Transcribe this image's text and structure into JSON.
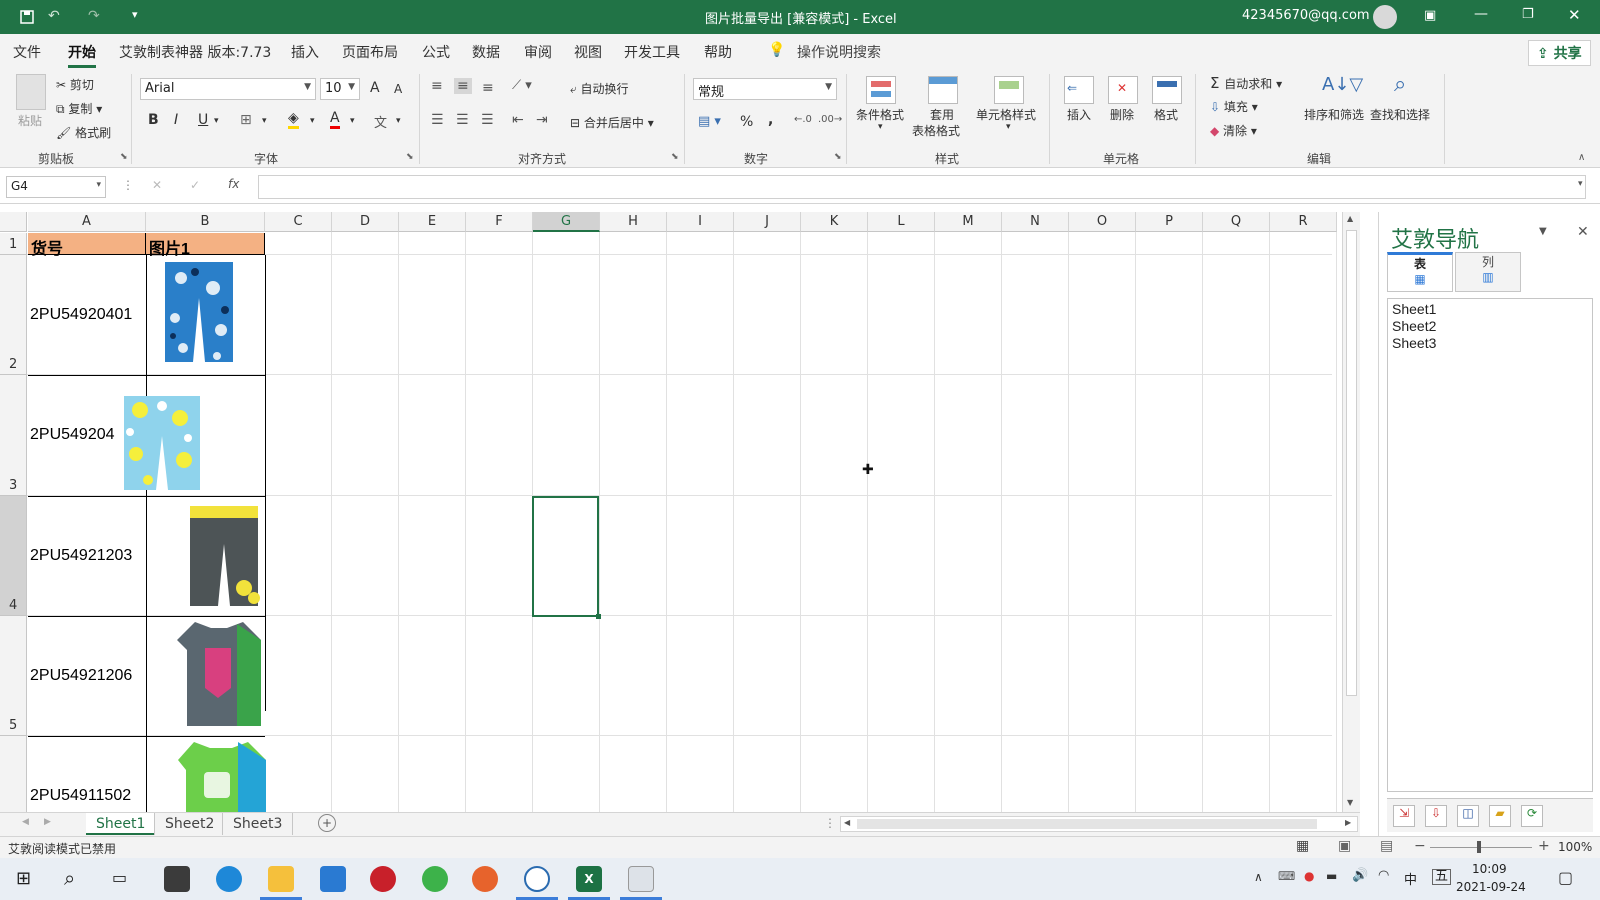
{
  "window": {
    "title": "图片批量导出 [兼容模式] - Excel",
    "account": "42345670@qq.com",
    "brand_color": "#217346"
  },
  "qat": {
    "save_icon": "save-icon",
    "undo_icon": "undo-icon",
    "redo_icon": "redo-icon"
  },
  "tabs": [
    {
      "label": "文件"
    },
    {
      "label": "开始"
    },
    {
      "label": "艾敦制表神器 版本:7.73"
    },
    {
      "label": "插入"
    },
    {
      "label": "页面布局"
    },
    {
      "label": "公式"
    },
    {
      "label": "数据"
    },
    {
      "label": "审阅"
    },
    {
      "label": "视图"
    },
    {
      "label": "开发工具"
    },
    {
      "label": "帮助"
    }
  ],
  "tell_me": "操作说明搜索",
  "share": "共享",
  "ribbon": {
    "clipboard": {
      "paste": "粘贴",
      "cut": "剪切",
      "copy": "复制",
      "format_painter": "格式刷",
      "label": "剪贴板"
    },
    "font": {
      "name": "Arial",
      "size": "10",
      "label": "字体",
      "bold": "B",
      "italic": "I",
      "underline": "U",
      "grow": "A",
      "shrink": "A",
      "font_color": "A"
    },
    "alignment": {
      "wrap": "自动换行",
      "merge": "合并后居中",
      "label": "对齐方式"
    },
    "number": {
      "format": "常规",
      "percent": "%",
      "comma": ",",
      "label": "数字"
    },
    "styles": {
      "conditional": "条件格式",
      "table_line1": "套用",
      "table_line2": "表格格式",
      "cell_styles": "单元格样式",
      "label": "样式"
    },
    "cells": {
      "insert": "插入",
      "delete": "删除",
      "format": "格式",
      "label": "单元格"
    },
    "editing": {
      "autosum": "自动求和",
      "fill": "填充",
      "clear": "清除",
      "sort": "排序和筛选",
      "find": "查找和选择",
      "label": "编辑"
    }
  },
  "formula_bar": {
    "name_box": "G4",
    "fx": "fx",
    "value": ""
  },
  "grid": {
    "columns": [
      "A",
      "B",
      "C",
      "D",
      "E",
      "F",
      "G",
      "H",
      "I",
      "J",
      "K",
      "L",
      "M",
      "N",
      "O",
      "P",
      "Q",
      "R"
    ],
    "rows": [
      "1",
      "2",
      "3",
      "4",
      "5"
    ],
    "header_row": {
      "a": "货号",
      "b": "图片1"
    },
    "header_fill": "#f4b183",
    "codes": [
      "2PU54920401",
      "2PU549204",
      "2PU54921203",
      "2PU54921206",
      "2PU54911502"
    ],
    "selected_cell": "G4"
  },
  "nav_pane": {
    "title": "艾敦导航",
    "tab_table": "表",
    "tab_column": "列",
    "sheets": [
      "Sheet1",
      "Sheet2",
      "Sheet3"
    ]
  },
  "sheet_tabs": [
    "Sheet1",
    "Sheet2",
    "Sheet3"
  ],
  "status": {
    "text": "艾敦阅读模式已禁用",
    "zoom": "100%"
  },
  "taskbar": {
    "time": "10:09",
    "date": "2021-09-24",
    "ime": "中",
    "weekday": "五"
  }
}
